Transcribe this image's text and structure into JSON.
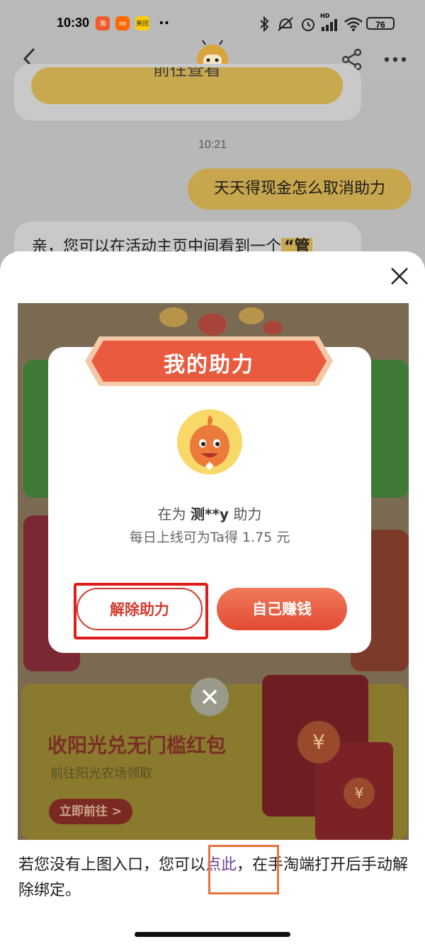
{
  "status_bar": {
    "time": "10:30",
    "app_icons": [
      {
        "name": "taobao-icon",
        "label": "淘",
        "color": "#f05a28"
      },
      {
        "name": "mi-icon",
        "label": "mi",
        "color": "#ff6900"
      },
      {
        "name": "meituan-icon",
        "label": "美团",
        "color": "#ffd000"
      }
    ],
    "more": "··",
    "hd_label": "HD",
    "battery": "76"
  },
  "header": {
    "back_icon": "chevron-left-icon",
    "share_icon": "share-icon",
    "more_icon": "more-icon"
  },
  "chat": {
    "goto_button": "前往查看",
    "timestamp": "10:21",
    "user_message": "天天得现金怎么取消助力",
    "bot_message_prefix": "亲，您可以在活动主页中间看到一个",
    "bot_message_highlight": "“管"
  },
  "sheet": {
    "close_icon": "close-icon",
    "image": {
      "promo_title": "收阳光兑无门槛红包",
      "promo_subtitle": "前往阳光农场领取",
      "promo_button": "立即前往 >",
      "yen": "¥",
      "dialog": {
        "title": "我的助力",
        "helping_prefix": "在为",
        "helping_user": "测**y",
        "helping_suffix": "助力",
        "daily_earn": "每日上线可为Ta得 1.75 元",
        "cancel_button": "解除助力",
        "earn_button": "自己赚钱"
      }
    },
    "bottom": {
      "text_before": "若您没有上图入口，您可以",
      "link": "点此",
      "text_after": "，在手淘端打开后手动解除绑定。"
    }
  },
  "colors": {
    "accent_gold": "#c9a94f",
    "red": "#e44a33",
    "link": "#6b3fa0",
    "annotation_red": "#e01b1b",
    "annotation_orange": "#e87240"
  }
}
